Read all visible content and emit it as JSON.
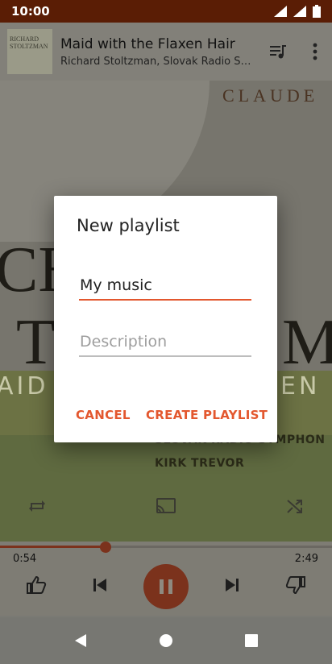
{
  "status_bar": {
    "time": "10:00"
  },
  "now_playing": {
    "title": "Maid with the Flaxen Hair",
    "artist": "Richard Stoltzman, Slovak Radio Sym...",
    "thumb_text": "RICHARD STOLTZMAN"
  },
  "album_art": {
    "brand_text": "CLAUDE",
    "big_text_1": "CH",
    "big_text_2": "T",
    "big_text_3": "M",
    "band_text_left": "AID",
    "band_text_right": "EN",
    "credit_1": "SLOVAK RADIO SYMPHON",
    "credit_2": "KIRK TREVOR"
  },
  "progress": {
    "elapsed": "0:54",
    "duration": "2:49",
    "fraction": 0.319
  },
  "dialog": {
    "title": "New playlist",
    "name_value": "My music",
    "description_placeholder": "Description",
    "cancel_label": "CANCEL",
    "create_label": "CREATE PLAYLIST"
  },
  "colors": {
    "accent": "#e3572e",
    "status_bar": "#5a1d05"
  }
}
